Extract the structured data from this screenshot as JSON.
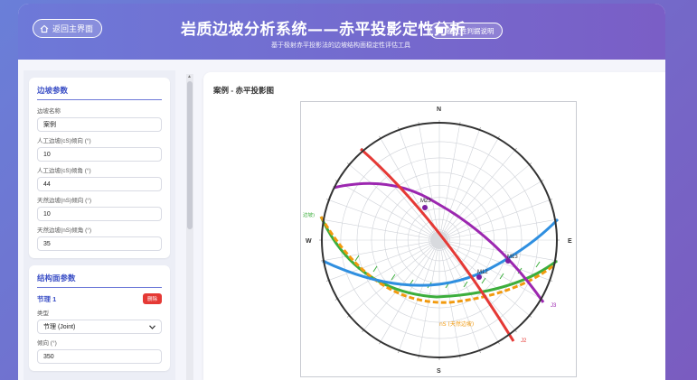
{
  "header": {
    "home_button": "返回主界面",
    "title": "岩质边坡分析系统——赤平投影定性分析",
    "subtitle": "基于极射赤平投影法的边坡结构面稳定性评估工具",
    "help_button": "稳定性判据说明"
  },
  "slope_params": {
    "title": "边坡参数",
    "name_label": "边坡名称",
    "name_value": "案例",
    "cs_dipdir_label": "人工边坡(cS)倾向 (°)",
    "cs_dipdir_value": "10",
    "cs_dip_label": "人工边坡(cS)倾角 (°)",
    "cs_dip_value": "44",
    "ns_dipdir_label": "天然边坡(nS)倾向 (°)",
    "ns_dipdir_value": "10",
    "ns_dip_label": "天然边坡(nS)倾角 (°)",
    "ns_dip_value": "35"
  },
  "structure_params": {
    "title": "结构面参数",
    "joint_name": "节理 1",
    "delete_label": "删除",
    "type_label": "类型",
    "type_value": "节理 (Joint)",
    "dipdir_label": "倾向 (°)",
    "dipdir_value": "350"
  },
  "plot": {
    "title": "案例 - 赤平投影图",
    "north": "N",
    "south": "S",
    "east": "E",
    "west": "W",
    "labels": {
      "m23": "M23",
      "m13": "M13",
      "m12": "M12",
      "j2": "J2",
      "j3": "J3",
      "ns_label": "nS (天然边坡)",
      "cs_label": "边坡)"
    },
    "colors": {
      "j1": "#2f8fe0",
      "j2": "#e53935",
      "j3": "#9c27b0",
      "cs": "#3cae3c",
      "ns": "#f29a0e"
    }
  }
}
